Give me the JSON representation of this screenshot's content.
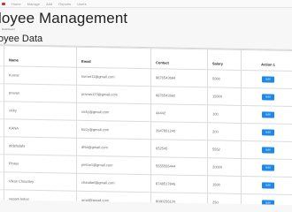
{
  "topbar": {
    "links": [
      "Home",
      "Manage",
      "Add",
      "Reports",
      "Users"
    ]
  },
  "page": {
    "title": "loyee Management",
    "breadcrumb": "Dashboard",
    "section_title": "oyee Data"
  },
  "table": {
    "headers": [
      "",
      "Name",
      "Email",
      "Contact",
      "Salary",
      "Action 1"
    ],
    "edit_label": "Edit",
    "rows": [
      {
        "id": "",
        "name": "Kumar",
        "email": "kumar11@gmail.com",
        "contact": "9876543694",
        "salary": "5000"
      },
      {
        "id": "",
        "name": "pravas",
        "email": "pravas123@gmail.com",
        "contact": "9876543692",
        "salary": "15000"
      },
      {
        "id": "",
        "name": "vicky",
        "email": "vicky@gmail.com",
        "contact": "44442",
        "salary": "100"
      },
      {
        "id": "",
        "name": "KANA",
        "email": "kizzy@gmail.com",
        "contact": "3947851240",
        "salary": "200"
      },
      {
        "id": "",
        "name": "dfdsfsdafs",
        "email": "dfsa@gmail.com",
        "contact": "652545",
        "salary": "5552"
      },
      {
        "id": "",
        "name": "Pintoo",
        "email": "pintoo1@gmail.com",
        "contact": "5555555444",
        "salary": "20000"
      },
      {
        "id": "",
        "name": "Vikas Choudary",
        "email": "chaudari@gmail.com",
        "contact": "8748517845",
        "salary": "1500"
      },
      {
        "id": "",
        "name": "yugam kekar",
        "email": "amal@gmail.com",
        "contact": "8080255120",
        "salary": "250"
      }
    ]
  }
}
